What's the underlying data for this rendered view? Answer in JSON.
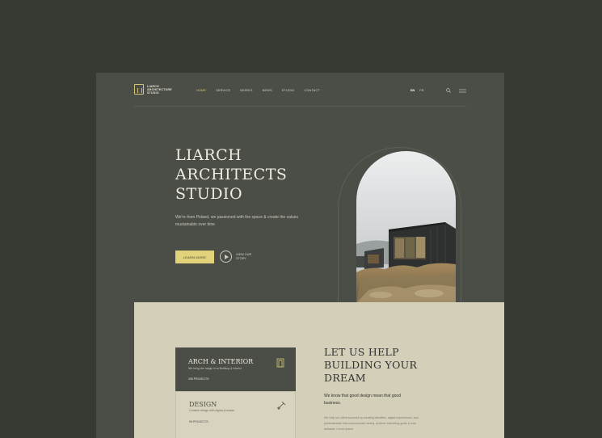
{
  "header": {
    "logo_lines": [
      "LIARCH",
      "ARCHITECTURE",
      "STUDIO"
    ],
    "nav": [
      "HOME",
      "SERVICE",
      "WORKS",
      "NEWS",
      "STUDIO",
      "CONTACT"
    ],
    "active_nav": "HOME",
    "languages": [
      "EN",
      "FR"
    ],
    "selected_language": "EN"
  },
  "hero": {
    "title_lines": [
      "LIARCH",
      "ARCHITECTS",
      "STUDIO"
    ],
    "subtitle": "We're from Poland, we passioned with the space & create the values mustainable over time",
    "learn_more": "LEARN MORE",
    "story_label": "VIEW OUR STORY"
  },
  "services": [
    {
      "title": "ARCH & INTERIOR",
      "desc": "We bring the magic in to Building & Interior",
      "count": "205 PROJECTS",
      "icon": "door-icon"
    },
    {
      "title": "DESIGN",
      "desc": "Creative design with digital products",
      "count": "95 PROJECTS",
      "icon": "compass-icon"
    }
  ],
  "help": {
    "title_lines": [
      "LET US HELP",
      "BUILDING YOUR",
      "DREAM"
    ],
    "lead": "We know that good design mean that good business.",
    "body": "We help our client succeed by creating identities, digital experiences, and printmaterials that communicate clearly, achieve marketing goals & look fantastic. Lorem ipsum"
  },
  "colors": {
    "background": "#363a33",
    "panel": "#4a4e46",
    "accent": "#e2d27a",
    "beige": "#d4cfb9"
  }
}
